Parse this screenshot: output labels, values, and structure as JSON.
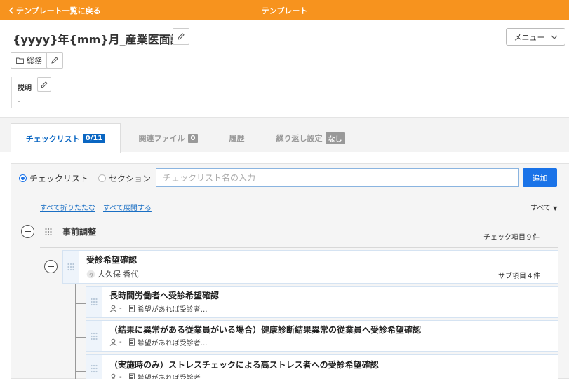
{
  "topbar": {
    "back_label": "テンプレート一覧に戻る",
    "title": "テンプレート"
  },
  "header": {
    "title": "{yyyy}年{mm}月_産業医面談",
    "menu_label": "メニュー",
    "folder_label": "総務",
    "description_label": "説明",
    "description_value": "-"
  },
  "tabs": [
    {
      "label": "チェックリスト",
      "badge": "0/11"
    },
    {
      "label": "関連ファイル",
      "badge": "0"
    },
    {
      "label": "履歴",
      "badge": ""
    },
    {
      "label": "繰り返し設定",
      "badge": "なし"
    }
  ],
  "add_form": {
    "radio_checklist": "チェックリスト",
    "radio_section": "セクション",
    "placeholder": "チェックリスト名の入力",
    "add_label": "追加"
  },
  "controls": {
    "collapse_all": "すべて折りたたむ",
    "expand_all": "すべて展開する",
    "filter_label": "すべて"
  },
  "section": {
    "title": "事前調整",
    "count": "チェック項目９件"
  },
  "parent_item": {
    "title": "受診希望確認",
    "assignee": "大久保 香代",
    "count": "サブ項目４件"
  },
  "sub_items": [
    {
      "title": "長時間労働者へ受診希望確認",
      "assignee": "-",
      "note": "希望があれば受診者…"
    },
    {
      "title": "（結果に異常がある従業員がいる場合）健康診断結果異常の従業員へ受診希望確認",
      "assignee": "-",
      "note": "希望があれば受診者…"
    },
    {
      "title": "（実施時のみ）ストレスチェックによる高ストレス者への受診希望確認",
      "assignee": "-",
      "note": "希望があれば受診者…"
    }
  ],
  "colors": {
    "topbar": "#f7931e",
    "accent": "#1a73e8",
    "tab_active": "#0a66c2"
  }
}
